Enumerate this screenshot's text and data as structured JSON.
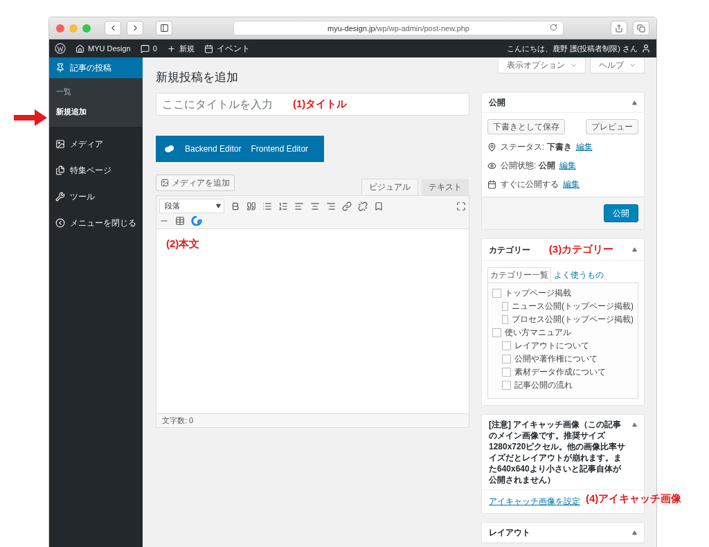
{
  "browser": {
    "url_domain": "myu-design.jp",
    "url_path": "/wp/wp-admin/post-new.php"
  },
  "admin_bar": {
    "site": "MYU Design",
    "comments": "0",
    "new": "新規",
    "event": "イベント",
    "greeting": "こんにちは、鹿野 護(投稿者制限) さん"
  },
  "sidebar": {
    "items": [
      {
        "label": "記事の投稿",
        "kind": "posts",
        "selected": true,
        "children": [
          {
            "label": "一覧",
            "selected": false
          },
          {
            "label": "新規追加",
            "selected": true
          }
        ]
      },
      {
        "label": "メディア",
        "kind": "media",
        "selected": false
      },
      {
        "label": "特集ページ",
        "kind": "pages",
        "selected": false
      },
      {
        "label": "ツール",
        "kind": "tools",
        "selected": false
      },
      {
        "label": "メニューを閉じる",
        "kind": "collapse",
        "selected": false
      }
    ]
  },
  "screen_tabs": [
    "表示オプション",
    "ヘルプ"
  ],
  "page_title": "新規投稿を追加",
  "title_field": {
    "placeholder": "ここにタイトルを入力"
  },
  "builder_buttons": [
    "Backend Editor",
    "Frontend Editor"
  ],
  "add_media": "メディアを追加",
  "editor_tabs": [
    {
      "label": "ビジュアル",
      "selected": true
    },
    {
      "label": "テキスト",
      "selected": false
    }
  ],
  "format_select": "段落",
  "word_count": "文字数: 0",
  "publish_box": {
    "title": "公開",
    "save_draft": "下書きとして保存",
    "preview": "プレビュー",
    "rows": [
      {
        "kind": "status",
        "label": "ステータス: ",
        "value": "下書き",
        "link": "編集"
      },
      {
        "kind": "visibility",
        "label": "公開状態: ",
        "value": "公開",
        "link": "編集"
      },
      {
        "kind": "schedule",
        "label": "すぐに公開する",
        "value": "",
        "link": "編集"
      }
    ],
    "publish": "公開"
  },
  "category_box": {
    "title": "カテゴリー",
    "tabs": [
      {
        "label": "カテゴリー一覧",
        "selected": true
      },
      {
        "label": "よく使うもの",
        "selected": false
      }
    ],
    "items": [
      {
        "label": "トップページ掲載",
        "checked": false,
        "children": [
          {
            "label": "ニュース公開(トップページ掲載)",
            "checked": false
          },
          {
            "label": "プロセス公開(トップページ掲載)",
            "checked": false
          }
        ]
      },
      {
        "label": "使い方マニュアル",
        "checked": false,
        "children": [
          {
            "label": "レイアウトについて",
            "checked": false
          },
          {
            "label": "公開や著作権について",
            "checked": false
          },
          {
            "label": "素材データ作成について",
            "checked": false
          },
          {
            "label": "記事公開の流れ",
            "checked": false
          }
        ]
      }
    ]
  },
  "featured_box": {
    "title": "[注意] アイキャッチ画像（この記事のメイン画像です。推奨サイズ1280x720ピクセル。他の画像比率サイズだとレイアウトが崩れます。また640x640より小さいと記事自体が公開されません）",
    "link": "アイキャッチ画像を設定"
  },
  "layout_box": {
    "title": "レイアウト"
  },
  "annotations": {
    "title": "(1)タイトル",
    "body": "(2)本文",
    "category": "(3)カテゴリー",
    "featured": "(4)アイキャッチ画像"
  }
}
